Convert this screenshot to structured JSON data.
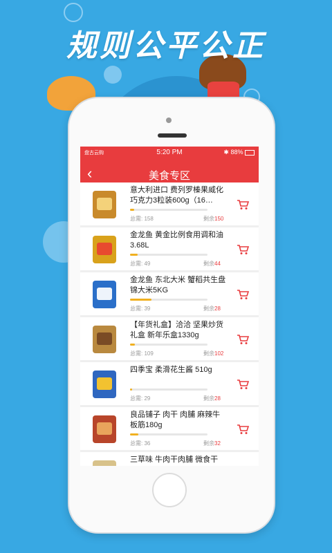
{
  "headline": "规则公平公正",
  "status": {
    "carrier": "盘古云购",
    "time": "5:20 PM",
    "battery": "88%"
  },
  "nav": {
    "back_icon": "chevron-left-icon",
    "title": "美食专区"
  },
  "colors": {
    "accent": "#e83c3e",
    "progress": "#f0b020",
    "background": "#38a8e3"
  },
  "labels": {
    "total_prefix": "总需: ",
    "remain_prefix": "剩余"
  },
  "products": [
    {
      "name": "意大利进口 费列罗榛果威化巧克力3粒装600g（16…",
      "total": "158",
      "remain": "150",
      "progress": 0.05
    },
    {
      "name": "金龙鱼 黄金比例食用调和油3.68L",
      "total": "49",
      "remain": "44",
      "progress": 0.1
    },
    {
      "name": "金龙鱼 东北大米 蟹稻共生盘锦大米5KG",
      "total": "39",
      "remain": "28",
      "progress": 0.28
    },
    {
      "name": "【年货礼盒】洽洽 坚果炒货礼盒 新年乐盒1330g",
      "total": "109",
      "remain": "102",
      "progress": 0.06
    },
    {
      "name": "四季宝 柔滑花生酱 510g",
      "total": "29",
      "remain": "28",
      "progress": 0.03
    },
    {
      "name": "良品铺子 肉干 肉脯 麻辣牛板筋180g",
      "total": "36",
      "remain": "32",
      "progress": 0.11
    },
    {
      "name": "三草味 牛肉干肉脯 微食干",
      "total": "",
      "remain": "",
      "progress": 0
    }
  ]
}
